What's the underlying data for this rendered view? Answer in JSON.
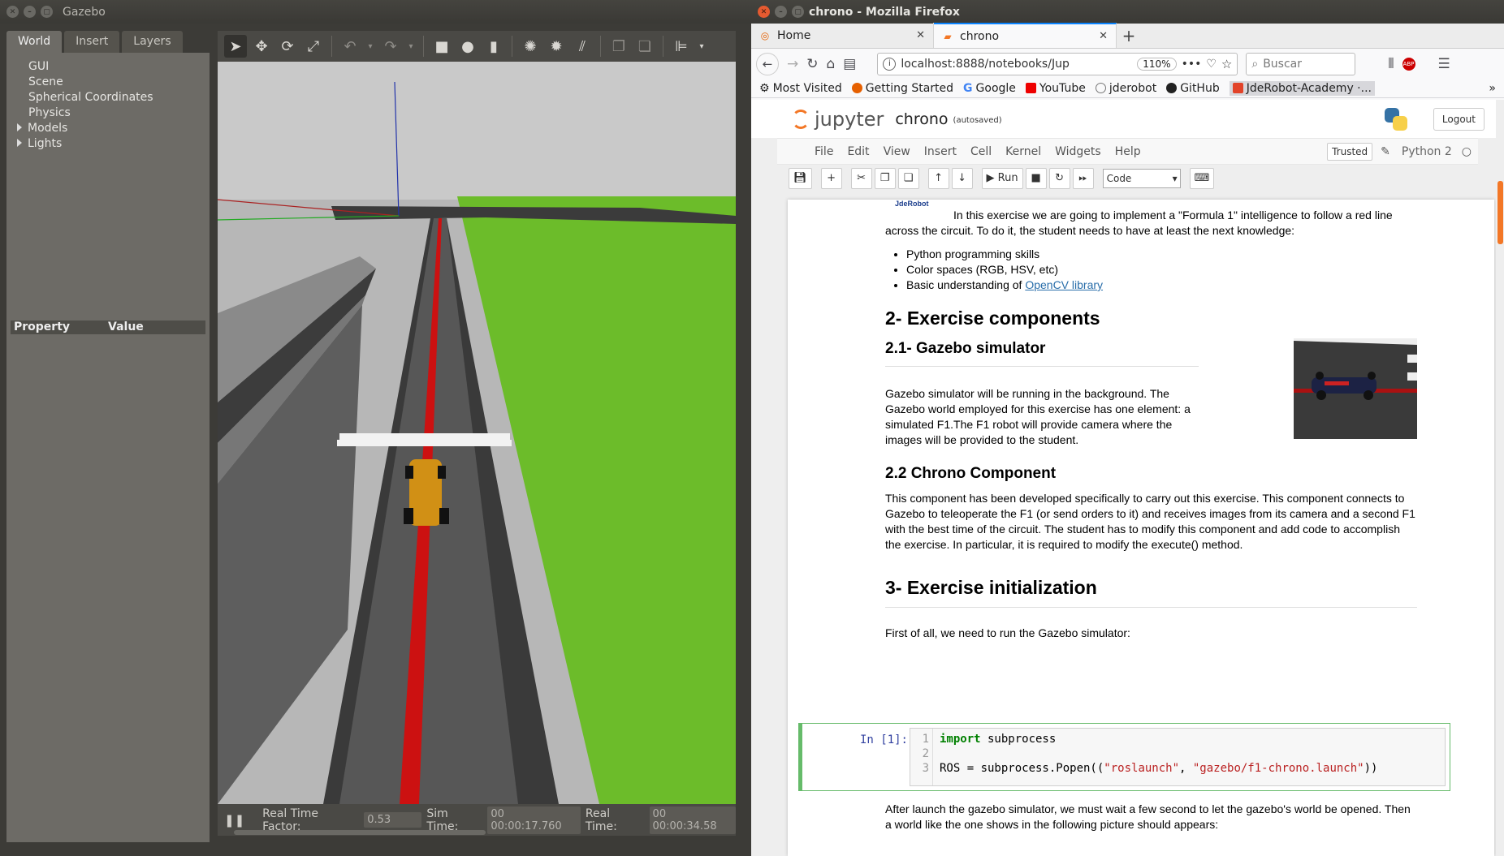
{
  "gazebo": {
    "title": "Gazebo",
    "tabs": [
      "World",
      "Insert",
      "Layers"
    ],
    "tree": [
      "GUI",
      "Scene",
      "Spherical Coordinates",
      "Physics",
      "Models",
      "Lights"
    ],
    "property_header": "Property",
    "value_header": "Value",
    "status": {
      "rtf_label": "Real Time Factor:",
      "rtf_value": "0.53",
      "sim_label": "Sim Time:",
      "sim_value": "00 00:00:17.760",
      "real_label": "Real Time:",
      "real_value": "00 00:00:34.58"
    }
  },
  "firefox": {
    "title": "chrono - Mozilla Firefox",
    "tabs": [
      {
        "label": "Home"
      },
      {
        "label": "chrono"
      }
    ],
    "url": "localhost:8888/notebooks/Jup",
    "zoom": "110%",
    "search_placeholder": "Buscar",
    "bookmarks": [
      "Most Visited",
      "Getting Started",
      "Google",
      "YouTube",
      "jderobot",
      "GitHub",
      "JdeRobot-Academy ·..."
    ]
  },
  "jupyter": {
    "logo_text": "jupyter",
    "notebook_name": "chrono",
    "autosave": "(autosaved)",
    "logout": "Logout",
    "menu": [
      "File",
      "Edit",
      "View",
      "Insert",
      "Cell",
      "Kernel",
      "Widgets",
      "Help"
    ],
    "trusted": "Trusted",
    "kernel": "Python 2",
    "run_label": "Run",
    "cell_type": "Code",
    "content": {
      "logo_caption": "JdeRobot",
      "intro": "In this exercise we are going to implement a \"Formula 1\" intelligence to follow a red line across the circuit. To do it, the student needs to have at least the next knowledge:",
      "bullets": [
        "Python programming skills",
        "Color spaces (RGB, HSV, etc)"
      ],
      "bullet3_prefix": "Basic understanding of ",
      "bullet3_link": "OpenCV library",
      "h2_components": "2- Exercise components",
      "h3_gazebo": "2.1- Gazebo simulator",
      "p_gazebo": "Gazebo simulator will be running in the background. The Gazebo world employed for this exercise has one element: a simulated F1.The F1 robot will provide camera where the images will be provided to the student.",
      "h3_chrono": "2.2 Chrono Component",
      "p_chrono": "This component has been developed specifically to carry out this exercise. This component connects to Gazebo to teleoperate the F1 (or send orders to it) and receives images from its camera and a second F1 with the best time of the circuit. The student has to modify this component and add code to accomplish the exercise. In particular, it is required to modify the execute() method.",
      "h2_init": "3- Exercise initialization",
      "p_first": "First of all, we need to run the Gazebo simulator:",
      "cell_prompt": "In [1]:",
      "code_line_numbers": [
        "1",
        "2",
        "3"
      ],
      "p_after": "After launch the gazebo simulator, we must wait a few second to let the gazebo's world be opened. Then a world like the one shows in the following picture should appears:"
    }
  }
}
